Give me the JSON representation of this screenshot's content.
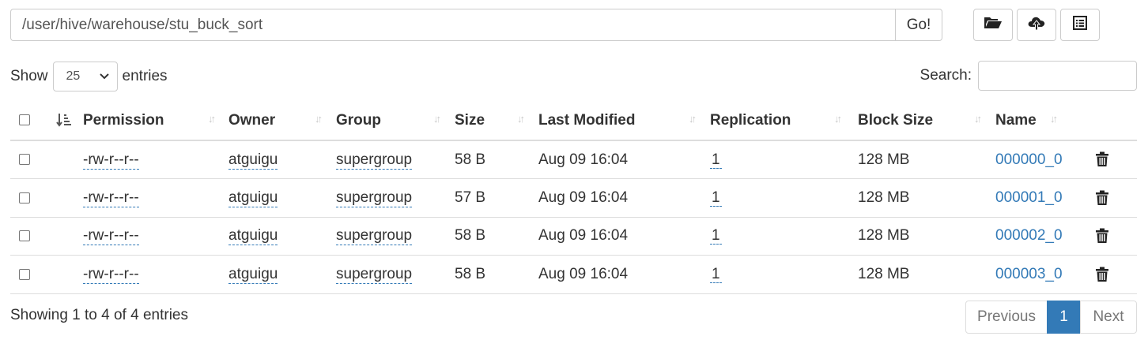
{
  "path_bar": {
    "value": "/user/hive/warehouse/stu_buck_sort",
    "go_label": "Go!"
  },
  "toolbar": {
    "icons": [
      "folder-open-icon",
      "upload-cloud-icon",
      "list-alt-icon"
    ]
  },
  "length_control": {
    "show_label": "Show",
    "selected": "25",
    "entries_label": "entries"
  },
  "search": {
    "label": "Search:",
    "value": ""
  },
  "table": {
    "columns": [
      "Permission",
      "Owner",
      "Group",
      "Size",
      "Last Modified",
      "Replication",
      "Block Size",
      "Name"
    ],
    "rows": [
      {
        "permission": "-rw-r--r--",
        "owner": "atguigu",
        "group": "supergroup",
        "size": "58 B",
        "modified": "Aug 09 16:04",
        "replication": "1",
        "block_size": "128 MB",
        "name": "000000_0"
      },
      {
        "permission": "-rw-r--r--",
        "owner": "atguigu",
        "group": "supergroup",
        "size": "57 B",
        "modified": "Aug 09 16:04",
        "replication": "1",
        "block_size": "128 MB",
        "name": "000001_0"
      },
      {
        "permission": "-rw-r--r--",
        "owner": "atguigu",
        "group": "supergroup",
        "size": "58 B",
        "modified": "Aug 09 16:04",
        "replication": "1",
        "block_size": "128 MB",
        "name": "000002_0"
      },
      {
        "permission": "-rw-r--r--",
        "owner": "atguigu",
        "group": "supergroup",
        "size": "58 B",
        "modified": "Aug 09 16:04",
        "replication": "1",
        "block_size": "128 MB",
        "name": "000003_0"
      }
    ]
  },
  "footer": {
    "info": "Showing 1 to 4 of 4 entries"
  },
  "pagination": {
    "previous": "Previous",
    "current": "1",
    "next": "Next"
  },
  "colors": {
    "link": "#337ab7",
    "active_page": "#337ab7",
    "border": "#dddddd"
  }
}
